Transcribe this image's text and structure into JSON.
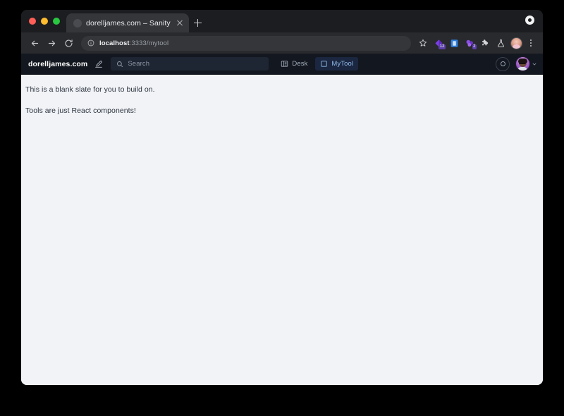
{
  "browser": {
    "window_controls": [
      "close",
      "minimize",
      "zoom"
    ],
    "tab": {
      "title": "dorelljames.com – Sanity",
      "close_label": "×"
    },
    "new_tab_label": "+",
    "toolbar": {
      "back_label": "Back",
      "forward_label": "Forward",
      "reload_label": "Reload",
      "omnibox": {
        "host": "localhost",
        "path": ":3333/mytool",
        "full_url": "localhost:3333/mytool"
      },
      "bookmark_label": "Bookmark this tab",
      "extensions": [
        {
          "name": "extension-purple-diamond",
          "badge": "12"
        },
        {
          "name": "extension-blue-square",
          "badge": ""
        },
        {
          "name": "extension-purple-cluster",
          "badge": "2"
        },
        {
          "name": "extension-puzzle-piece",
          "badge": ""
        },
        {
          "name": "extension-flask",
          "badge": ""
        }
      ],
      "profile_label": "Profile",
      "menu_label": "Customize and control Google Chrome"
    }
  },
  "studio": {
    "title": "dorelljames.com",
    "compose_label": "Create new document",
    "search": {
      "placeholder": "Search",
      "value": ""
    },
    "tools": [
      {
        "label": "Desk",
        "icon": "structure-panel-icon",
        "active": false
      },
      {
        "label": "MyTool",
        "icon": "square-icon",
        "active": true
      }
    ],
    "presence_label": "Presence",
    "user_label": "User menu",
    "chevron_label": "▾"
  },
  "content": {
    "lines": [
      "This is a blank slate for you to build on.",
      "Tools are just React components!"
    ]
  },
  "colors": {
    "accent": "#8fb8e8",
    "accent_bg": "#1b2740",
    "navbar_bg": "#13171f",
    "page_bg": "#f1f3f6",
    "browser_toolbar": "#292a2d",
    "tab_active": "#35363a"
  }
}
